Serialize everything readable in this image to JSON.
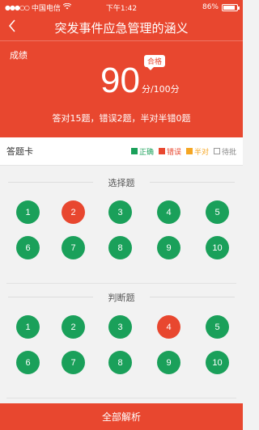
{
  "status": {
    "carrier": "中国电信",
    "time": "下午1:42",
    "battery": "86%",
    "battery_level": 0.86
  },
  "nav": {
    "back_icon": "chevron-left-icon",
    "title": "突发事件应急管理的涵义"
  },
  "result": {
    "label": "成绩",
    "score": "90",
    "total": "分/100分",
    "badge": "合格",
    "summary": "答对15题，错误2题，半对半错0题"
  },
  "card": {
    "title": "答题卡",
    "legend": [
      {
        "label": "正确",
        "color": "#1aa05a",
        "outline": false
      },
      {
        "label": "错误",
        "color": "#e8472f",
        "outline": false
      },
      {
        "label": "半对",
        "color": "#f5a623",
        "outline": false
      },
      {
        "label": "待批",
        "color": "#ffffff",
        "outline": true
      }
    ]
  },
  "sections": [
    {
      "title": "选择题",
      "questions": [
        {
          "n": "1",
          "status": "correct"
        },
        {
          "n": "2",
          "status": "wrong"
        },
        {
          "n": "3",
          "status": "correct"
        },
        {
          "n": "4",
          "status": "correct"
        },
        {
          "n": "5",
          "status": "correct"
        },
        {
          "n": "6",
          "status": "correct"
        },
        {
          "n": "7",
          "status": "correct"
        },
        {
          "n": "8",
          "status": "correct"
        },
        {
          "n": "9",
          "status": "correct"
        },
        {
          "n": "10",
          "status": "correct"
        }
      ]
    },
    {
      "title": "判断题",
      "questions": [
        {
          "n": "1",
          "status": "correct"
        },
        {
          "n": "2",
          "status": "correct"
        },
        {
          "n": "3",
          "status": "correct"
        },
        {
          "n": "4",
          "status": "wrong"
        },
        {
          "n": "5",
          "status": "correct"
        },
        {
          "n": "6",
          "status": "correct"
        },
        {
          "n": "7",
          "status": "correct"
        },
        {
          "n": "8",
          "status": "correct"
        },
        {
          "n": "9",
          "status": "correct"
        },
        {
          "n": "10",
          "status": "correct"
        }
      ]
    }
  ],
  "colors": {
    "correct": "#1aa05a",
    "wrong": "#e8472f",
    "half": "#f5a623",
    "accent": "#e8472f"
  },
  "footer": {
    "label": "全部解析"
  }
}
